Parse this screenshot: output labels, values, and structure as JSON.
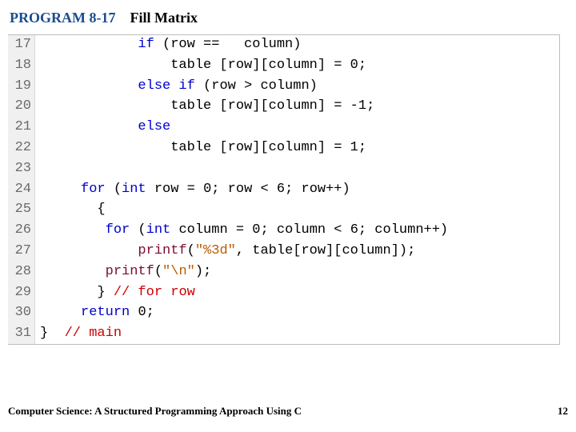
{
  "heading": {
    "program_label": "PROGRAM 8-17",
    "program_title": "Fill Matrix"
  },
  "code_lines": [
    {
      "n": "17",
      "tokens": [
        {
          "t": "            ",
          "c": ""
        },
        {
          "t": "if",
          "c": "kw"
        },
        {
          "t": " (row ==   column)",
          "c": ""
        }
      ]
    },
    {
      "n": "18",
      "tokens": [
        {
          "t": "                table [row][column] = ",
          "c": ""
        },
        {
          "t": "0",
          "c": "num"
        },
        {
          "t": ";",
          "c": ""
        }
      ]
    },
    {
      "n": "19",
      "tokens": [
        {
          "t": "            ",
          "c": ""
        },
        {
          "t": "else if",
          "c": "kw"
        },
        {
          "t": " (row > column)",
          "c": ""
        }
      ]
    },
    {
      "n": "20",
      "tokens": [
        {
          "t": "                table [row][column] = -",
          "c": ""
        },
        {
          "t": "1",
          "c": "num"
        },
        {
          "t": ";",
          "c": ""
        }
      ]
    },
    {
      "n": "21",
      "tokens": [
        {
          "t": "            ",
          "c": ""
        },
        {
          "t": "else",
          "c": "kw"
        }
      ]
    },
    {
      "n": "22",
      "tokens": [
        {
          "t": "                table [row][column] = ",
          "c": ""
        },
        {
          "t": "1",
          "c": "num"
        },
        {
          "t": ";",
          "c": ""
        }
      ]
    },
    {
      "n": "23",
      "tokens": []
    },
    {
      "n": "24",
      "tokens": [
        {
          "t": "     ",
          "c": ""
        },
        {
          "t": "for",
          "c": "kw"
        },
        {
          "t": " (",
          "c": ""
        },
        {
          "t": "int",
          "c": "kw"
        },
        {
          "t": " row = ",
          "c": ""
        },
        {
          "t": "0",
          "c": "num"
        },
        {
          "t": "; row < ",
          "c": ""
        },
        {
          "t": "6",
          "c": "num"
        },
        {
          "t": "; row++)",
          "c": ""
        }
      ]
    },
    {
      "n": "25",
      "tokens": [
        {
          "t": "       {",
          "c": ""
        }
      ]
    },
    {
      "n": "26",
      "tokens": [
        {
          "t": "        ",
          "c": ""
        },
        {
          "t": "for",
          "c": "kw"
        },
        {
          "t": " (",
          "c": ""
        },
        {
          "t": "int",
          "c": "kw"
        },
        {
          "t": " column = ",
          "c": ""
        },
        {
          "t": "0",
          "c": "num"
        },
        {
          "t": "; column < ",
          "c": ""
        },
        {
          "t": "6",
          "c": "num"
        },
        {
          "t": "; column++)",
          "c": ""
        }
      ]
    },
    {
      "n": "27",
      "tokens": [
        {
          "t": "            ",
          "c": ""
        },
        {
          "t": "printf",
          "c": "fn"
        },
        {
          "t": "(",
          "c": ""
        },
        {
          "t": "\"%3d\"",
          "c": "str"
        },
        {
          "t": ", table[row][column]);",
          "c": ""
        }
      ]
    },
    {
      "n": "28",
      "tokens": [
        {
          "t": "        ",
          "c": ""
        },
        {
          "t": "printf",
          "c": "fn"
        },
        {
          "t": "(",
          "c": ""
        },
        {
          "t": "\"\\n\"",
          "c": "str"
        },
        {
          "t": ");",
          "c": ""
        }
      ]
    },
    {
      "n": "29",
      "tokens": [
        {
          "t": "       } ",
          "c": ""
        },
        {
          "t": "// for row",
          "c": "cmt"
        }
      ]
    },
    {
      "n": "30",
      "tokens": [
        {
          "t": "     ",
          "c": ""
        },
        {
          "t": "return",
          "c": "kw"
        },
        {
          "t": " ",
          "c": ""
        },
        {
          "t": "0",
          "c": "num"
        },
        {
          "t": ";",
          "c": ""
        }
      ]
    },
    {
      "n": "31",
      "tokens": [
        {
          "t": "}  ",
          "c": ""
        },
        {
          "t": "// main",
          "c": "cmt"
        }
      ]
    }
  ],
  "footer": {
    "left": "Computer Science: A Structured Programming Approach Using C",
    "right": "12"
  }
}
